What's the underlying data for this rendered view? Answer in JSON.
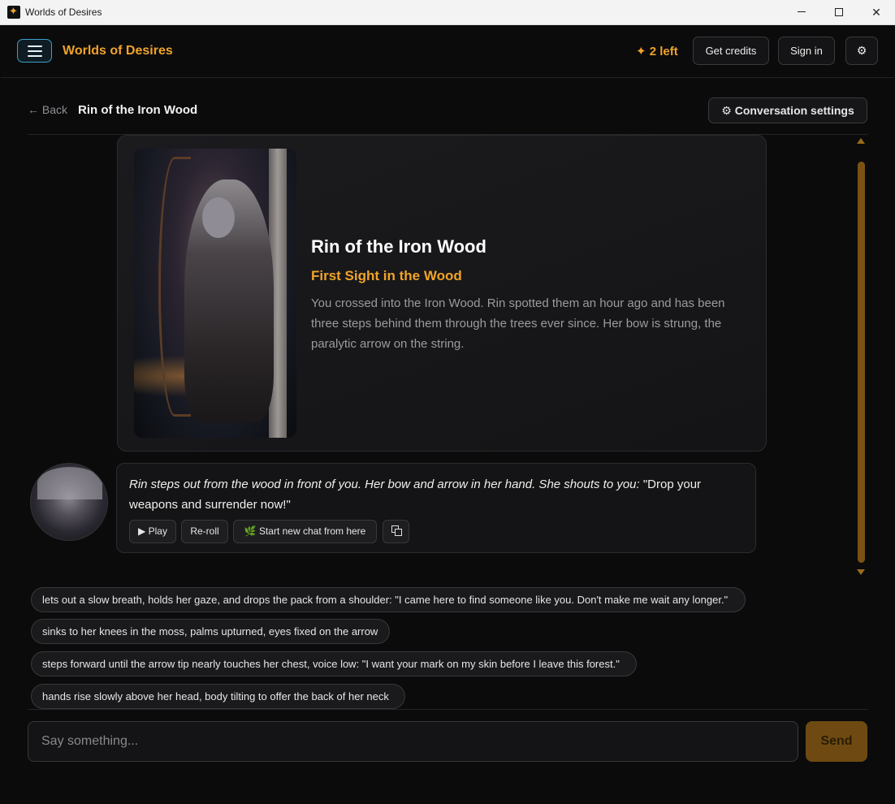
{
  "window": {
    "title": "Worlds of Desires"
  },
  "header": {
    "brand": "Worlds of Desires",
    "credits": "✦ 2 left",
    "get_credits": "Get credits",
    "sign_in": "Sign in",
    "settings_icon": "⚙"
  },
  "subheader": {
    "back": "← Back",
    "title": "Rin of the Iron Wood",
    "conversation_settings": "⚙ Conversation settings"
  },
  "scenario": {
    "name": "Rin of the Iron Wood",
    "subtitle": "First Sight in the Wood",
    "description": "You crossed into the Iron Wood. Rin spotted them an hour ago and has been three steps behind them through the trees ever since. Her bow is strung, the paralytic arrow on the string."
  },
  "message": {
    "action": "Rin steps out from the wood in front of you. Her bow and arrow in her hand. She shouts to you:",
    "speech": " \"Drop your weapons and surrender now!\"",
    "play": "▶ Play",
    "reroll": "Re-roll",
    "new_chat": "Start new chat from here"
  },
  "suggestions": [
    "lets out a slow breath, holds her gaze, and drops the pack from a shoulder: \"I came here to find someone like you. Don't make me wait any longer.\"",
    "sinks to her knees in the moss, palms upturned, eyes fixed on the arrow",
    "steps forward until the arrow tip nearly touches her chest, voice low: \"I want your mark on my skin before I leave this forest.\"",
    "hands rise slowly above her head, body tilting to offer the back of her neck"
  ],
  "composer": {
    "placeholder": "Say something...",
    "send": "Send"
  },
  "colors": {
    "accent": "#f0a32a",
    "background": "#0b0b0c",
    "send_button": "#6e4a12"
  }
}
